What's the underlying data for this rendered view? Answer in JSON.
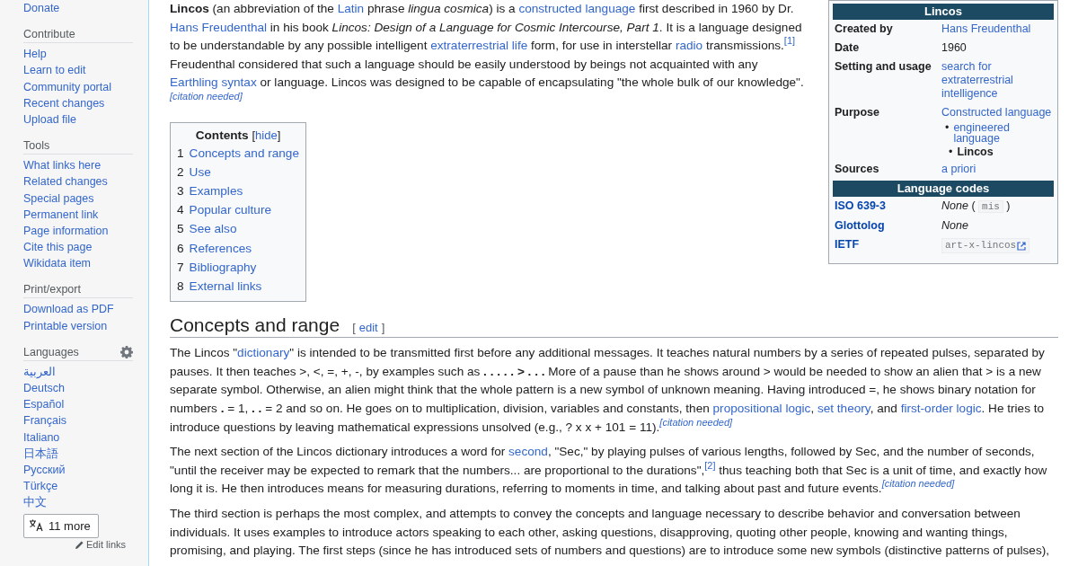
{
  "sidebar": {
    "top_links": [
      "Donate"
    ],
    "sections": [
      {
        "title": "Contribute",
        "kind": "links",
        "items": [
          "Help",
          "Learn to edit",
          "Community portal",
          "Recent changes",
          "Upload file"
        ]
      },
      {
        "title": "Tools",
        "kind": "links",
        "items": [
          "What links here",
          "Related changes",
          "Special pages",
          "Permanent link",
          "Page information",
          "Cite this page",
          "Wikidata item"
        ]
      },
      {
        "title": "Print/export",
        "kind": "links",
        "items": [
          "Download as PDF",
          "Printable version"
        ]
      },
      {
        "title": "Languages",
        "kind": "languages",
        "items": [
          "العربية",
          "Deutsch",
          "Español",
          "Français",
          "Italiano",
          "日本語",
          "Русский",
          "Türkçe",
          "中文"
        ]
      }
    ],
    "more_button": "11 more",
    "edit_links": "Edit links"
  },
  "infobox": {
    "title": "Lincos",
    "rows": [
      {
        "label": "Created by",
        "values": [
          {
            "kind": "link",
            "text": "Hans Freudenthal"
          }
        ]
      },
      {
        "label": "Date",
        "values": [
          {
            "kind": "text",
            "text": "1960"
          }
        ]
      },
      {
        "label": "Setting and usage",
        "values": [
          {
            "kind": "link",
            "text": "search for extraterrestrial intelligence"
          }
        ]
      },
      {
        "label": "Purpose",
        "values": [
          {
            "kind": "link",
            "text": "Constructed language"
          },
          {
            "kind": "bullet-link",
            "marker": "•",
            "text": "engineered language"
          },
          {
            "kind": "subbullet-bold",
            "marker": "•",
            "text": "Lincos"
          }
        ]
      },
      {
        "label": "Sources",
        "values": [
          {
            "kind": "link",
            "text": "a priori"
          }
        ]
      }
    ],
    "codes_title": "Language codes",
    "code_rows": [
      {
        "label": "ISO 639-3",
        "values": [
          {
            "kind": "italic",
            "text": "None"
          },
          {
            "kind": "text",
            "text": "("
          },
          {
            "kind": "code",
            "text": "mis"
          },
          {
            "kind": "text",
            "text": ")"
          }
        ]
      },
      {
        "label": "Glottolog",
        "values": [
          {
            "kind": "italic",
            "text": "None"
          }
        ]
      },
      {
        "label": "IETF",
        "values": [
          {
            "kind": "code-link",
            "text": "art-x-lincos"
          }
        ]
      }
    ]
  },
  "intro": [
    [
      {
        "kind": "bold",
        "text": "Lincos"
      },
      {
        "kind": "text",
        "text": " (an abbreviation of the "
      },
      {
        "kind": "link",
        "text": "Latin"
      },
      {
        "kind": "text",
        "text": " phrase "
      },
      {
        "kind": "italic",
        "text": "lingua cosmica"
      },
      {
        "kind": "text",
        "text": ") is a "
      },
      {
        "kind": "link",
        "text": "constructed language"
      },
      {
        "kind": "text",
        "text": " first described in 1960 by Dr. "
      },
      {
        "kind": "link",
        "text": "Hans Freudenthal"
      },
      {
        "kind": "text",
        "text": " in his book "
      },
      {
        "kind": "italic",
        "text": "Lincos: Design of a Language for Cosmic Intercourse, Part 1"
      },
      {
        "kind": "text",
        "text": ". It is a language designed to be understandable by any possible intelligent "
      },
      {
        "kind": "link",
        "text": "extraterrestrial life"
      },
      {
        "kind": "text",
        "text": " form, for use in interstellar "
      },
      {
        "kind": "link",
        "text": "radio"
      },
      {
        "kind": "text",
        "text": " transmissions."
      },
      {
        "kind": "ref",
        "text": "[1]"
      },
      {
        "kind": "text",
        "text": " Freudenthal considered that such a language should be easily understood by beings not acquainted with any "
      },
      {
        "kind": "link",
        "text": "Earthling syntax"
      },
      {
        "kind": "text",
        "text": " or language. Lincos was designed to be capable of encapsulating \"the whole bulk of our knowledge\"."
      },
      {
        "kind": "cite",
        "text": "[citation needed]"
      }
    ]
  ],
  "toc": {
    "title": "Contents",
    "toggle": {
      "open": "[",
      "label": "hide",
      "close": "]"
    },
    "items": [
      {
        "number": "1",
        "label": "Concepts and range"
      },
      {
        "number": "2",
        "label": "Use"
      },
      {
        "number": "3",
        "label": "Examples"
      },
      {
        "number": "4",
        "label": "Popular culture"
      },
      {
        "number": "5",
        "label": "See also"
      },
      {
        "number": "6",
        "label": "References"
      },
      {
        "number": "7",
        "label": "Bibliography"
      },
      {
        "number": "8",
        "label": "External links"
      }
    ]
  },
  "section": {
    "heading": "Concepts and range",
    "edit": {
      "open": "[",
      "label": "edit",
      "close": "]"
    },
    "paragraphs": [
      [
        {
          "kind": "text",
          "text": "The Lincos \""
        },
        {
          "kind": "link",
          "text": "dictionary"
        },
        {
          "kind": "text",
          "text": "\" is intended to be transmitted first before any additional messages. It teaches natural numbers by a series of repeated pulses, separated by pauses. It then teaches >, <, =, +, -, by examples such as "
        },
        {
          "kind": "bold",
          "text": ". . . . . > . . ."
        },
        {
          "kind": "text",
          "text": " More of a pause than he shows around > would be needed to show an alien that > is a new separate symbol. Otherwise, an alien might think that the whole pattern is a new symbol of unknown meaning. Having introduced =, he shows binary notation for numbers "
        },
        {
          "kind": "bold",
          "text": "."
        },
        {
          "kind": "text",
          "text": " = 1, "
        },
        {
          "kind": "bold",
          "text": ". ."
        },
        {
          "kind": "text",
          "text": " = 2 and so on. He goes on to multiplication, division, variables and constants, then "
        },
        {
          "kind": "link",
          "text": "propositional logic"
        },
        {
          "kind": "text",
          "text": ", "
        },
        {
          "kind": "link",
          "text": "set theory"
        },
        {
          "kind": "text",
          "text": ", and "
        },
        {
          "kind": "link",
          "text": "first-order logic"
        },
        {
          "kind": "text",
          "text": ". He tries to introduce questions by leaving mathematical expressions unsolved (e.g., ? x x + 101 = 11)."
        },
        {
          "kind": "cite",
          "text": "[citation needed]"
        }
      ],
      [
        {
          "kind": "text",
          "text": "The next section of the Lincos dictionary introduces a word for "
        },
        {
          "kind": "link",
          "text": "second"
        },
        {
          "kind": "text",
          "text": ", \"Sec,\" by playing pulses of various lengths, followed by Sec, and the number of seconds, \"until the receiver may be expected to remark that the numbers... are proportional to the durations\","
        },
        {
          "kind": "ref",
          "text": "[2]"
        },
        {
          "kind": "text",
          "text": " thus teaching both that Sec is a unit of time, and exactly how long it is. He then introduces means for measuring durations, referring to moments in time, and talking about past and future events."
        },
        {
          "kind": "cite",
          "text": "[citation needed]"
        }
      ],
      [
        {
          "kind": "text",
          "text": "The third section is perhaps the most complex, and attempts to convey the concepts and language necessary to describe behavior and conversation between individuals. It uses examples to introduce actors speaking to each other, asking questions, disapproving, quoting other people, knowing and wanting things, promising, and playing. The first steps (since he has introduced sets of numbers and questions) are to introduce some new symbols (distinctive patterns of pulses),"
        }
      ]
    ]
  }
}
